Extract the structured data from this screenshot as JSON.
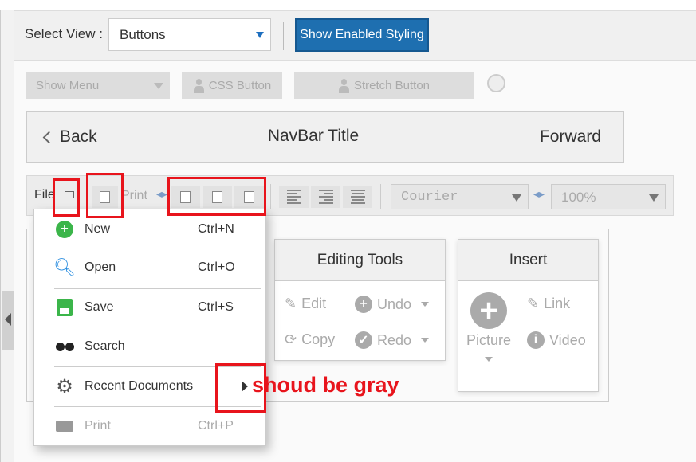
{
  "header": {
    "select_view_label": "Select View :",
    "select_value": "Buttons",
    "enabled_styling_button": "Show Enabled Styling"
  },
  "buttons_row": {
    "show_menu": "Show Menu",
    "css_button": "CSS Button",
    "stretch_button": "Stretch Button"
  },
  "navbar": {
    "back": "Back",
    "title": "NavBar Title",
    "forward": "Forward"
  },
  "toolbar": {
    "file": "File",
    "print": "Print",
    "font": "Courier",
    "zoom": "100%"
  },
  "groups": {
    "editing": {
      "title": "Editing Tools",
      "edit": "Edit",
      "undo": "Undo",
      "copy": "Copy",
      "redo": "Redo"
    },
    "insert": {
      "title": "Insert",
      "picture": "Picture",
      "link": "Link",
      "video": "Video"
    }
  },
  "file_menu": {
    "items": [
      {
        "label": "New",
        "shortcut": "Ctrl+N",
        "icon": "plus-circle-icon"
      },
      {
        "label": "Open",
        "shortcut": "Ctrl+O",
        "icon": "magnifier-icon"
      },
      {
        "label": "Save",
        "shortcut": "Ctrl+S",
        "icon": "floppy-icon"
      },
      {
        "label": "Search",
        "shortcut": "",
        "icon": "binoculars-icon"
      },
      {
        "label": "Recent Documents",
        "shortcut": "",
        "icon": "gear-icon"
      },
      {
        "label": "Print",
        "shortcut": "Ctrl+P",
        "icon": "printer-icon",
        "disabled": true
      }
    ]
  },
  "annotation": {
    "text": "shoud be gray",
    "color": "#e8141c"
  },
  "colors": {
    "accent": "#1e6fb0",
    "annotation": "#e8141c",
    "success": "#3bb54a"
  }
}
